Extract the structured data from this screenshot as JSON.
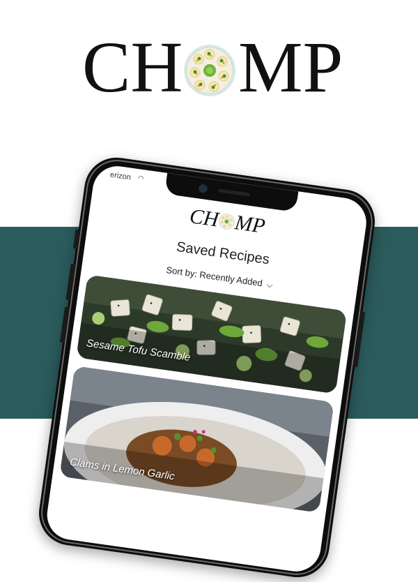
{
  "brand": {
    "name_left": "CH",
    "name_right": "MP",
    "app_left": "CH",
    "app_right": "MP"
  },
  "status": {
    "carrier": "erizon"
  },
  "screen": {
    "title": "Saved Recipes",
    "sort_label": "Sort by: Recently Added"
  },
  "recipes": [
    {
      "name": "Sesame Tofu Scamble"
    },
    {
      "name": "Clams in Lemon Garlic"
    }
  ],
  "colors": {
    "teal": "#2b5b5c",
    "plate": "#dbe9e6",
    "plate_center": "#7fbf3f"
  }
}
